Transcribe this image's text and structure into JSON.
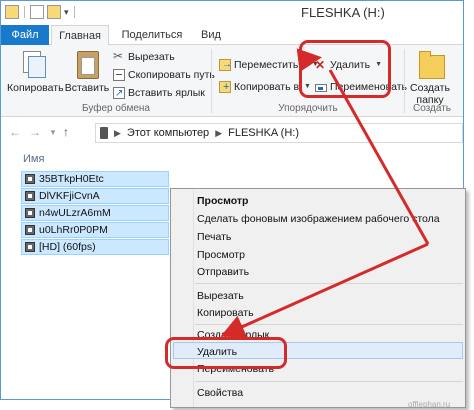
{
  "window": {
    "title": "FLESHKA (H:)"
  },
  "tabs": [
    "Файл",
    "Главная",
    "Поделиться",
    "Вид"
  ],
  "ribbon": {
    "clipboard": {
      "copy": "Копировать",
      "paste": "Вставить",
      "cut": "Вырезать",
      "copy_path": "Скопировать путь",
      "paste_shortcut": "Вставить ярлык",
      "label": "Буфер обмена"
    },
    "organize": {
      "move_to": "Переместить в",
      "copy_to": "Копировать в",
      "delete": "Удалить",
      "rename": "Переименовать",
      "label": "Упорядочить"
    },
    "new": {
      "new_folder_line1": "Создать",
      "new_folder_line2": "папку",
      "label": "Создать"
    }
  },
  "address": {
    "crumbs": [
      "Этот компьютер",
      "FLESHKA (H:)"
    ]
  },
  "file_list": {
    "column_name": "Имя",
    "items": [
      "35BTkpH0Etc",
      "DlVKFjiCvnA",
      "n4wULzrA6mM",
      "u0LhRr0P0PM",
      "[HD] (60fps)"
    ]
  },
  "context_menu": {
    "items": [
      "Просмотр",
      "Сделать фоновым изображением рабочего стола",
      "Печать",
      "Просмотр",
      "Отправить",
      "Вырезать",
      "Копировать",
      "Создать ярлык",
      "Удалить",
      "Переименовать",
      "Свойства"
    ]
  },
  "watermark": "offlephan.ru",
  "colors": {
    "accent": "#1979ca",
    "highlight": "#d42a2a",
    "selection": "#cce8ff"
  }
}
